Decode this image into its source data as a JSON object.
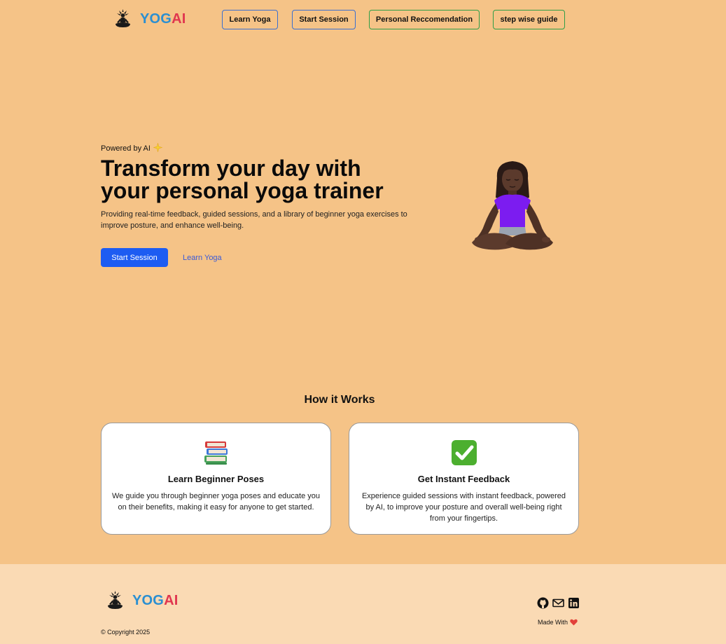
{
  "brand": {
    "yog": "YOG",
    "ai": "AI"
  },
  "nav": {
    "learn_yoga": "Learn Yoga",
    "start_session": "Start Session",
    "personal_recommendation": "Personal Reccomendation",
    "step_wise_guide": "step wise guide"
  },
  "hero": {
    "tag": "Powered by AI",
    "title": "Transform your day with your personal yoga trainer",
    "description": "Providing real-time feedback, guided sessions, and a library of beginner yoga exercises to improve posture, and enhance well-being.",
    "primary_button": "Start Session",
    "secondary_link": "Learn Yoga"
  },
  "how_it_works": {
    "title": "How it Works",
    "cards": [
      {
        "icon": "books-icon",
        "title": "Learn Beginner Poses",
        "text": "We guide you through beginner yoga poses and educate you on their benefits, making it easy for anyone to get started."
      },
      {
        "icon": "check-icon",
        "title": "Get Instant Feedback",
        "text": "Experience guided sessions with instant feedback, powered by AI, to improve your posture and overall well-being right from your fingertips."
      }
    ]
  },
  "footer": {
    "made_with": "Made With",
    "copyright": "© Copyright 2025"
  },
  "colors": {
    "background": "#f5c387",
    "footer_background": "#fadab4",
    "primary": "#1d5cf2",
    "brand_blue": "#2b8fd1",
    "brand_red": "#e0364f"
  }
}
